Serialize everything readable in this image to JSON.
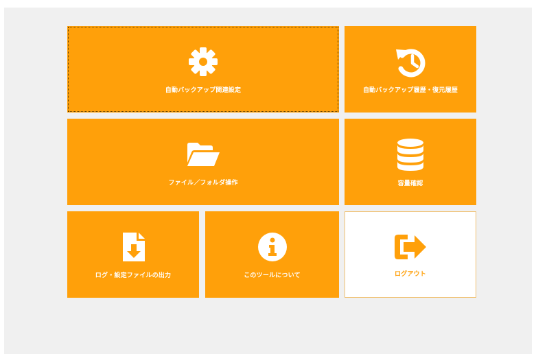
{
  "menu": {
    "tiles": [
      {
        "label": "自動バックアップ関連設定",
        "icon": "gear-icon"
      },
      {
        "label": "自動バックアップ履歴・復元履歴",
        "icon": "history-icon"
      },
      {
        "label": "ファイル／フォルダ操作",
        "icon": "folder-open-icon"
      },
      {
        "label": "容量確認",
        "icon": "database-icon"
      },
      {
        "label": "ログ・設定ファイルの出力",
        "icon": "file-download-icon"
      },
      {
        "label": "このツールについて",
        "icon": "info-icon"
      },
      {
        "label": "ログアウト",
        "icon": "sign-out-icon"
      }
    ]
  },
  "colors": {
    "tile": "#ffa00a",
    "background": "#f0f0f0",
    "logout_tile": "#ffffff"
  }
}
